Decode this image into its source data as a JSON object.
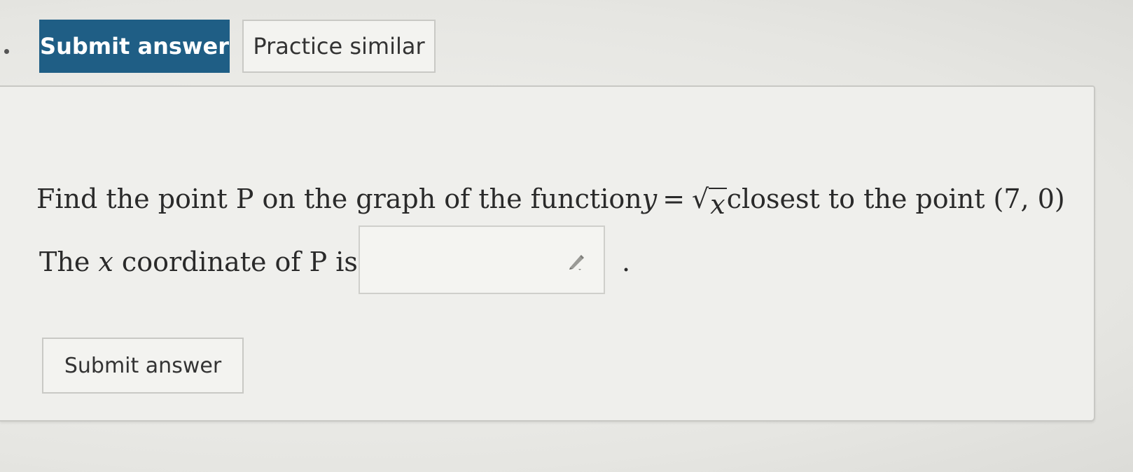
{
  "toolbar": {
    "submit_label": "Submit answer",
    "practice_label": "Practice similar"
  },
  "question": {
    "prefix": "Find the point P on the graph of the function ",
    "func_lhs": "y",
    "equals": "=",
    "sqrt_symbol": "√",
    "sqrt_arg": "x",
    "suffix": " closest to the point (7, 0)"
  },
  "answer": {
    "label_start": "The ",
    "label_var": "x",
    "label_end": " coordinate of P is:",
    "value": "",
    "period": "."
  },
  "footer": {
    "submit_label": "Submit answer"
  },
  "colors": {
    "primary": "#1f5e85",
    "page_bg": "#ebebe7"
  },
  "icons": [
    "pencil-icon"
  ]
}
